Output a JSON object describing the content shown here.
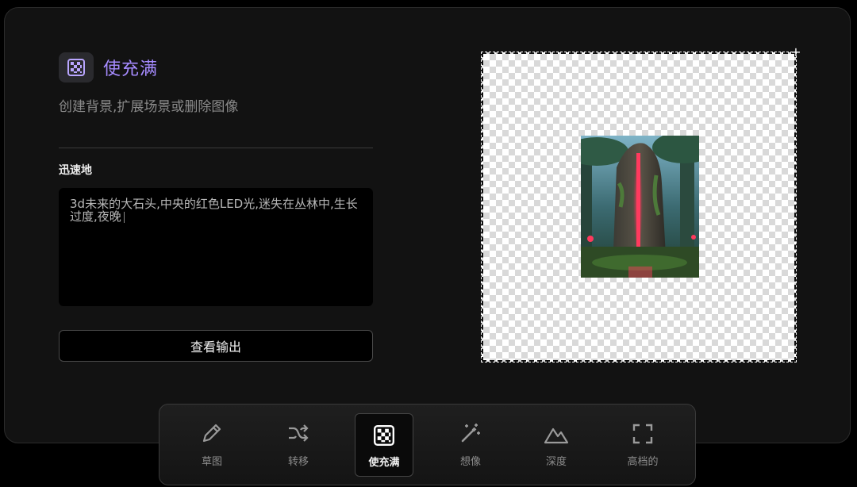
{
  "mode": {
    "title": "使充满",
    "subtitle": "创建背景,扩展场景或删除图像",
    "icon": "checkerboard-icon",
    "accent_color": "#a68bff"
  },
  "section": {
    "label": "迅速地"
  },
  "prompt": {
    "value": "3d未来的大石头,中央的红色LED光,迷失在丛林中,生长过度,夜晚"
  },
  "output_button": {
    "label": "查看输出"
  },
  "toolbar": {
    "tools": [
      {
        "label": "草图",
        "icon": "pencil-icon"
      },
      {
        "label": "转移",
        "icon": "shuffle-icon"
      },
      {
        "label": "使充满",
        "icon": "checkerboard-icon",
        "active": true
      },
      {
        "label": "想像",
        "icon": "magic-wand-icon"
      },
      {
        "label": "深度",
        "icon": "mountain-icon"
      },
      {
        "label": "高档的",
        "icon": "expand-icon"
      }
    ]
  }
}
